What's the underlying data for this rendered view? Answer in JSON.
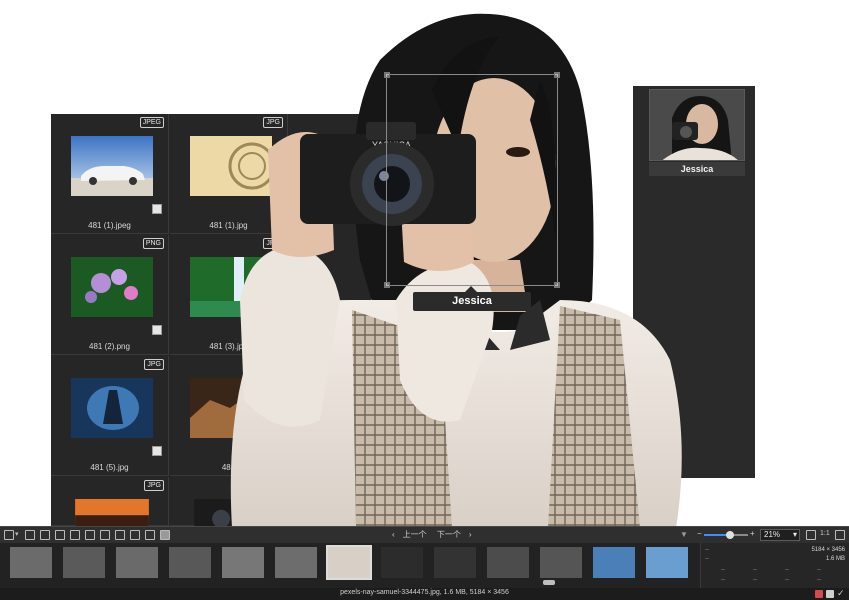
{
  "grid": {
    "cells": [
      {
        "badge": "JPEG",
        "name": "481 (1).jpeg",
        "thumb": "car-photo"
      },
      {
        "badge": "JPG",
        "name": "481 (1).jpg",
        "thumb": "stamp-photo"
      },
      {
        "badge": "PNG",
        "name": "481 (2).png",
        "thumb": "flowers-photo"
      },
      {
        "badge": "JPG",
        "name": "481 (3).jpg",
        "thumb": "waterfall-photo"
      },
      {
        "badge": "JPG",
        "name": "481 (5).jpg",
        "thumb": "warrior-photo"
      },
      {
        "badge": "",
        "name": "481",
        "thumb": "rocks-photo"
      },
      {
        "badge": "JPG",
        "name": "",
        "thumb": "sunset-photo"
      },
      {
        "badge": "",
        "name": "",
        "thumb": "camera-photo"
      }
    ]
  },
  "face_panel": {
    "name": "Jessica"
  },
  "face_tag": {
    "label": "Jessica"
  },
  "toolbar": {
    "prev_label": "上一个",
    "next_label": "下一个",
    "zoom_value": "21%",
    "zoom_fit": "1:1",
    "zoom_level": 0.6
  },
  "info": {
    "dimensions": "5184 × 3456",
    "size": "1.6 MB",
    "placeholder": "--"
  },
  "status": {
    "text": "pexels-nay-samuel-3344475.jpg, 1.6 MB, 5184 × 3456"
  },
  "colors": {
    "panel_bg": "#262626",
    "accent": "#3f8cff"
  }
}
